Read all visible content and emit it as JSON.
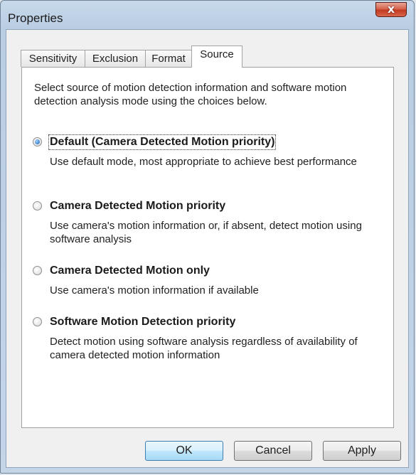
{
  "window": {
    "title": "Properties",
    "close_glyph": "x"
  },
  "tabs": [
    {
      "label": "Sensitivity",
      "active": false
    },
    {
      "label": "Exclusion",
      "active": false
    },
    {
      "label": "Format",
      "active": false
    },
    {
      "label": "Source",
      "active": true
    }
  ],
  "intro": "Select source of motion detection information and software motion detection analysis mode using the choices below.",
  "options": [
    {
      "label": "Default (Camera Detected Motion priority)",
      "description": "Use default mode, most appropriate to achieve best performance",
      "selected": true
    },
    {
      "label": "Camera Detected Motion priority",
      "description": "Use camera's motion information or, if absent, detect motion using software analysis",
      "selected": false
    },
    {
      "label": "Camera Detected Motion only",
      "description": "Use camera's motion information if available",
      "selected": false
    },
    {
      "label": "Software Motion Detection priority",
      "description": "Detect motion using software analysis regardless of availability of camera detected motion information",
      "selected": false
    }
  ],
  "buttons": {
    "ok": "OK",
    "cancel": "Cancel",
    "apply": "Apply"
  },
  "icons": {
    "close": "close-icon",
    "radio": "radio-button"
  },
  "colors": {
    "title_bar": "#b9cde3",
    "close_button": "#c0391f",
    "default_button_border": "#3c7fb1",
    "radio_selected": "#1a5fb4"
  }
}
